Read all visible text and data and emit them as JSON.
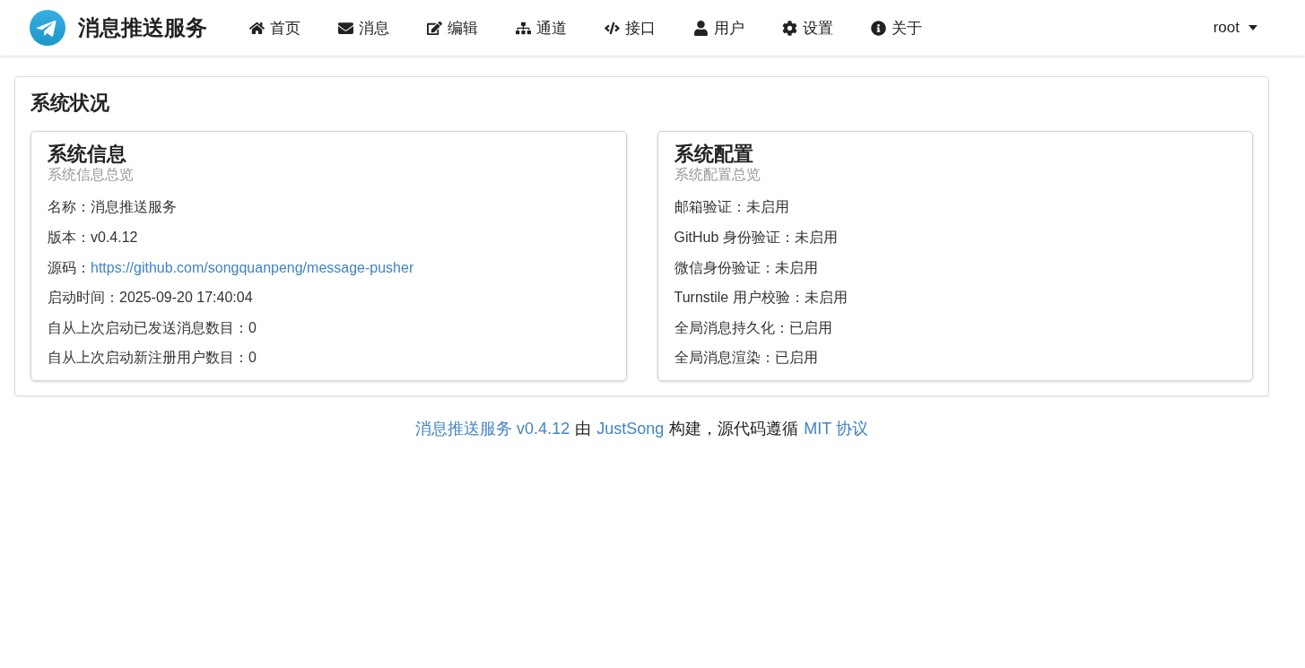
{
  "header": {
    "brand": "消息推送服务",
    "nav": [
      {
        "kind": "home",
        "label": "首页"
      },
      {
        "kind": "message",
        "label": "消息"
      },
      {
        "kind": "editor",
        "label": "编辑"
      },
      {
        "kind": "channel",
        "label": "通道"
      },
      {
        "kind": "api",
        "label": "接口"
      },
      {
        "kind": "user",
        "label": "用户"
      },
      {
        "kind": "setting",
        "label": "设置"
      },
      {
        "kind": "about",
        "label": "关于"
      }
    ],
    "user_menu": "root"
  },
  "panel": {
    "title": "系统状况",
    "cards": [
      {
        "title": "系统信息",
        "subtitle": "系统信息总览",
        "rows": [
          {
            "label": "名称：",
            "value": "消息推送服务",
            "kind": "text"
          },
          {
            "label": "版本：",
            "value": "v0.4.12",
            "kind": "text"
          },
          {
            "label": "源码：",
            "value": "https://github.com/songquanpeng/message-pusher",
            "kind": "link"
          },
          {
            "label": "启动时间：",
            "value": "2025-09-20 17:40:04",
            "kind": "text"
          },
          {
            "label": "自从上次启动已发送消息数目：",
            "value": "0",
            "kind": "text"
          },
          {
            "label": "自从上次启动新注册用户数目：",
            "value": "0",
            "kind": "text"
          }
        ]
      },
      {
        "title": "系统配置",
        "subtitle": "系统配置总览",
        "rows": [
          {
            "label": "邮箱验证：",
            "value": "未启用",
            "kind": "text"
          },
          {
            "label": "GitHub 身份验证：",
            "value": "未启用",
            "kind": "text"
          },
          {
            "label": "微信身份验证：",
            "value": "未启用",
            "kind": "text"
          },
          {
            "label": "Turnstile 用户校验：",
            "value": "未启用",
            "kind": "text"
          },
          {
            "label": "全局消息持久化：",
            "value": "已启用",
            "kind": "text"
          },
          {
            "label": "全局消息渲染：",
            "value": "已启用",
            "kind": "text"
          }
        ]
      }
    ]
  },
  "footer": [
    {
      "kind": "link",
      "text": "消息推送服务 v0.4.12"
    },
    {
      "kind": "text",
      "text": "由"
    },
    {
      "kind": "link",
      "text": "JustSong"
    },
    {
      "kind": "text",
      "text": "构建，源代码遵循"
    },
    {
      "kind": "link",
      "text": "MIT 协议"
    }
  ]
}
